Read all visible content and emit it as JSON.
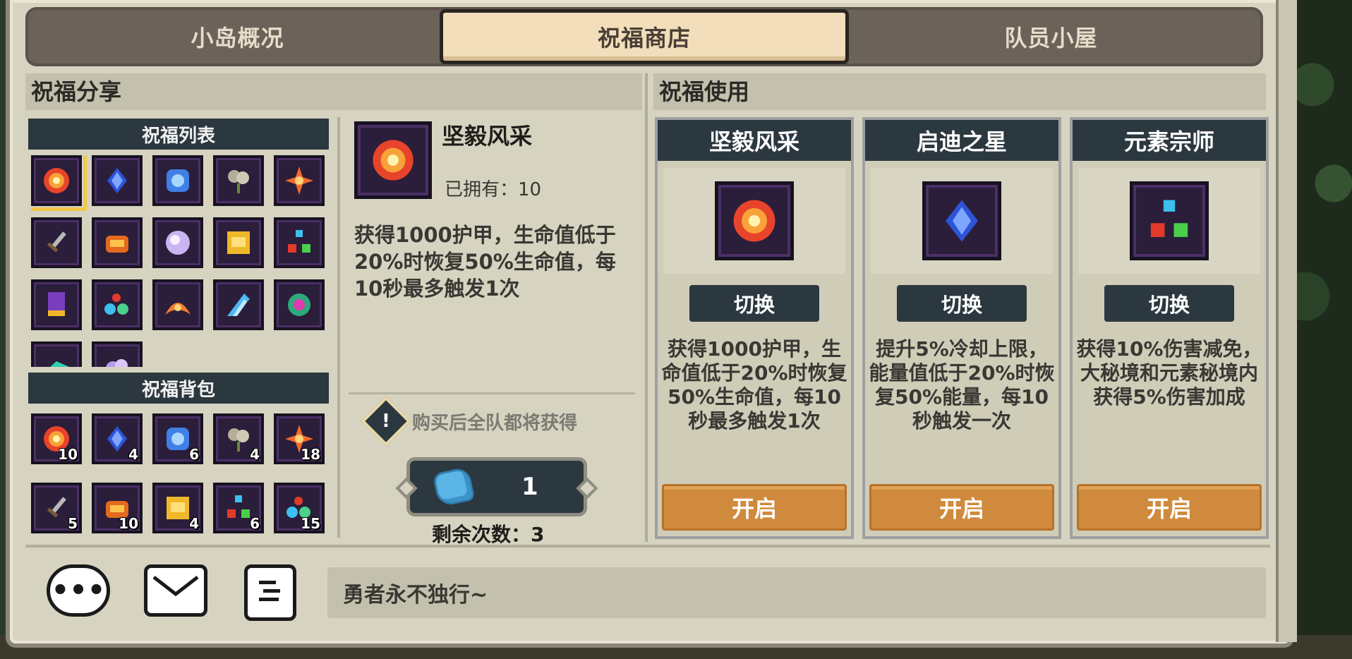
{
  "tabs": [
    {
      "label": "小岛概况"
    },
    {
      "label": "祝福商店"
    },
    {
      "label": "队员小屋"
    }
  ],
  "active_tab": "祝福商店",
  "share": {
    "title": "祝福分享",
    "list_title": "祝福列表",
    "bag_title": "祝福背包",
    "list_icons": [
      "burst",
      "blue-crystal",
      "frost",
      "gray-flower",
      "red-star",
      "sword",
      "fire-chest",
      "pink-orb",
      "gold-scroll",
      "tri-gem",
      "banner",
      "potions",
      "flame-wing",
      "ice-shard",
      "green-gear",
      "teal-shard",
      "purple-bubble"
    ],
    "bag_items": [
      {
        "icon": "burst",
        "count": "10"
      },
      {
        "icon": "blue-crystal",
        "count": "4"
      },
      {
        "icon": "frost",
        "count": "6"
      },
      {
        "icon": "gray-flower",
        "count": "4"
      },
      {
        "icon": "red-star",
        "count": "18"
      },
      {
        "icon": "sword",
        "count": "5"
      },
      {
        "icon": "fire-chest",
        "count": "10"
      },
      {
        "icon": "gold-scroll",
        "count": "4"
      },
      {
        "icon": "tri-gem",
        "count": "6"
      },
      {
        "icon": "potions",
        "count": "15"
      }
    ]
  },
  "detail": {
    "name": "坚毅风采",
    "owned": "已拥有：10",
    "description": "获得1000护甲，生命值低于20%时恢复50%生命值，每10秒最多触发1次",
    "notice": "购买后全队都将获得",
    "cost": "1",
    "remaining": "剩余次数：3"
  },
  "usage": {
    "title": "祝福使用",
    "switch_label": "切换",
    "open_label": "开启",
    "cards": [
      {
        "name": "坚毅风采",
        "icon": "burst",
        "description": "获得1000护甲，生命值低于20%时恢复50%生命值，每10秒最多触发1次"
      },
      {
        "name": "启迪之星",
        "icon": "blue-crystal",
        "description": "提升5%冷却上限，能量值低于20%时恢复50%能量，每10秒触发一次"
      },
      {
        "name": "元素宗师",
        "icon": "tri-gem",
        "description": "获得10%伤害减免，大秘境和元素秘境内获得5%伤害加成"
      }
    ]
  },
  "bottom": {
    "chat_placeholder": "勇者永不独行~"
  },
  "colors": {
    "panel": "#d6d3c0",
    "dark": "#2c3840",
    "orange": "#cf8a3d",
    "tab_active": "#f2deba",
    "selection": "#f2c84a"
  }
}
